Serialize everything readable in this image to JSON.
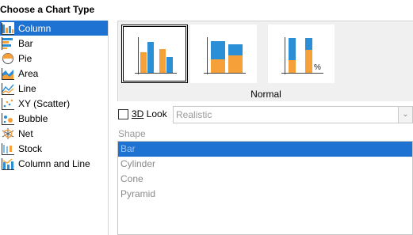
{
  "dialog": {
    "title": "Choose a Chart Type"
  },
  "chart_types": [
    {
      "label": "Column",
      "icon": "column-chart-icon",
      "selected": true
    },
    {
      "label": "Bar",
      "icon": "bar-chart-icon"
    },
    {
      "label": "Pie",
      "icon": "pie-chart-icon"
    },
    {
      "label": "Area",
      "icon": "area-chart-icon"
    },
    {
      "label": "Line",
      "icon": "line-chart-icon"
    },
    {
      "label": "XY (Scatter)",
      "icon": "scatter-chart-icon"
    },
    {
      "label": "Bubble",
      "icon": "bubble-chart-icon"
    },
    {
      "label": "Net",
      "icon": "net-chart-icon"
    },
    {
      "label": "Stock",
      "icon": "stock-chart-icon"
    },
    {
      "label": "Column and Line",
      "icon": "column-and-line-chart-icon"
    }
  ],
  "variants": {
    "items": [
      {
        "icon": "normal-column-variant-icon",
        "selected": true
      },
      {
        "icon": "stacked-column-variant-icon"
      },
      {
        "icon": "percent-stacked-column-variant-icon",
        "symbol": "%"
      }
    ],
    "selected_caption": "Normal"
  },
  "look_3d": {
    "label_prefix": "3D",
    "label_rest": " Look",
    "checked": false,
    "select_value": "Realistic",
    "enabled": false
  },
  "shape": {
    "label": "Shape",
    "options": [
      "Bar",
      "Cylinder",
      "Cone",
      "Pyramid"
    ],
    "selected": "Bar"
  },
  "colors": {
    "selection": "#1e73d2",
    "series_blue": "#2a8fd6",
    "series_orange": "#f6a03a",
    "panel_bg": "#f0f0f0",
    "disabled_text": "#9a9a9a"
  }
}
